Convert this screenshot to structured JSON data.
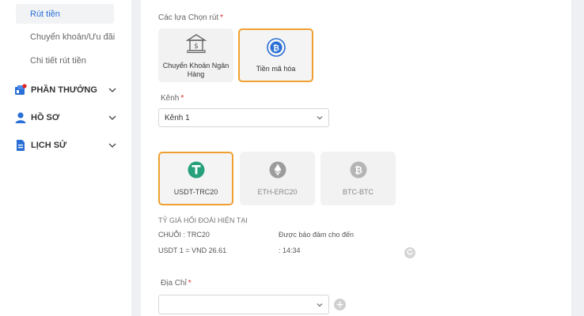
{
  "sidebar": {
    "sub_items": [
      "Rút tiền",
      "Chuyển khoản/Ưu đãi",
      "Chi tiết rút tiền"
    ],
    "menu": [
      {
        "label": "PHẦN THƯỞNG",
        "icon": "rewards-icon"
      },
      {
        "label": "HỒ SƠ",
        "icon": "profile-icon"
      },
      {
        "label": "LỊCH SỬ",
        "icon": "history-icon"
      }
    ]
  },
  "withdraw": {
    "options_label": "Các lựa Chọn rút",
    "options": [
      {
        "label": "Chuyển Khoản Ngân Hàng",
        "icon": "bank-icon"
      },
      {
        "label": "Tiền mã hóa",
        "icon": "bitcoin-icon"
      }
    ],
    "channel_label": "Kênh",
    "channel_value": "Kênh 1",
    "coins": [
      {
        "label": "USDT-TRC20",
        "icon": "tether-icon"
      },
      {
        "label": "ETH-ERC20",
        "icon": "ethereum-icon"
      },
      {
        "label": "BTC-BTC",
        "icon": "bitcoin-icon"
      }
    ],
    "rate": {
      "title": "TỶ GIÁ HỐI ĐOÁI HIỆN TẠI",
      "chain": "CHUỖI : TRC20",
      "guaranteed_label": "Được bảo đảm cho đến",
      "rate_value": "USDT 1 = VND 26.61",
      "time": ": 14:34"
    },
    "address_label": "Địa Chỉ",
    "address_value": ""
  },
  "colors": {
    "accent": "#f0a030",
    "active_link": "#2a6fd6",
    "required": "#e02424",
    "tether": "#26a17b",
    "bitcoin_blue": "#2a6fd6"
  }
}
